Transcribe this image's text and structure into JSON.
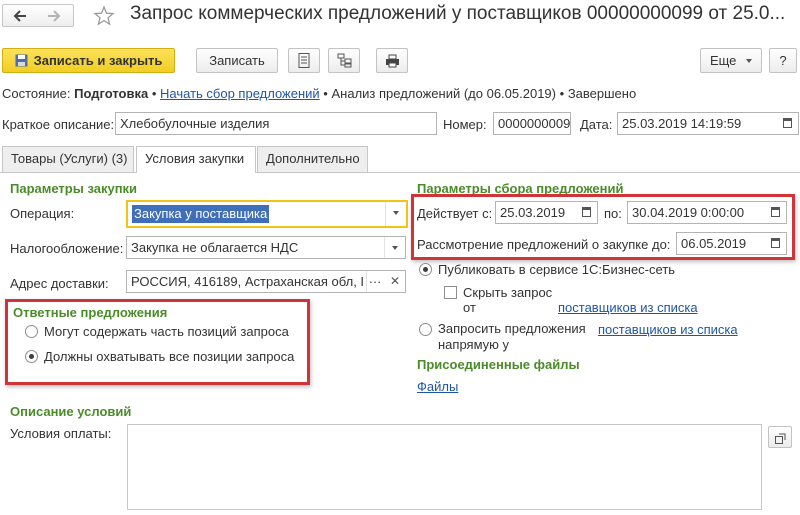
{
  "window": {
    "title": "Запрос коммерческих предложений у поставщиков 00000000099 от 25.0...",
    "colors": {
      "accent_button": "#f5d22d",
      "section_title": "#4b8c2a",
      "link": "#1f56a3",
      "highlight": "#d0343b"
    }
  },
  "toolbar": {
    "save_close_label": "Записать и закрыть",
    "save_label": "Записать",
    "more_label": "Еще",
    "help_label": "?"
  },
  "status": {
    "prefix": "Состояние:",
    "current": "Подготовка",
    "sep1": "•",
    "start_link": "Начать сбор предложений",
    "sep2": "•",
    "analysis": "Анализ предложений (до 06.05.2019)",
    "sep3": "•",
    "done": "Завершено"
  },
  "header_fields": {
    "description_label": "Краткое описание:",
    "description_value": "Хлебобулочные изделия",
    "number_label": "Номер:",
    "number_value": "0000000009",
    "date_label": "Дата:",
    "date_value": "25.03.2019 14:19:59"
  },
  "tabs": [
    {
      "label": "Товары (Услуги) (3)"
    },
    {
      "label": "Условия закупки"
    },
    {
      "label": "Дополнительно"
    }
  ],
  "purchase_params": {
    "title": "Параметры закупки",
    "operation_label": "Операция:",
    "operation_value": "Закупка у поставщика",
    "tax_label": "Налогообложение:",
    "tax_value": "Закупка не облагается НДС",
    "address_label": "Адрес доставки:",
    "address_value": "РОССИЯ, 416189, Астраханская обл, I"
  },
  "responses": {
    "title": "Ответные предложения",
    "option1": "Могут содержать часть позиций запроса",
    "option2": "Должны охватывать все позиции запроса",
    "selected": 2
  },
  "conditions": {
    "title": "Описание условий",
    "payment_label": "Условия оплаты:",
    "payment_value": ""
  },
  "collection_params": {
    "title": "Параметры сбора предложений",
    "valid_from_label": "Действует с:",
    "valid_from_value": "25.03.2019",
    "to_label": "по:",
    "to_value": "30.04.2019  0:00:00",
    "review_label": "Рассмотрение предложений о закупке до:",
    "review_value": "06.05.2019",
    "publish_label": "Публиковать в сервисе 1С:Бизнес-сеть",
    "hide_label_line1": "Скрыть запрос",
    "hide_label_line2": "от",
    "hide_link": "поставщиков из списка",
    "direct_label_line1": "Запросить предложения",
    "direct_label_line2": "напрямую у",
    "direct_link": "поставщиков из списка"
  },
  "files": {
    "title": "Присоединенные файлы",
    "link": "Файлы"
  }
}
